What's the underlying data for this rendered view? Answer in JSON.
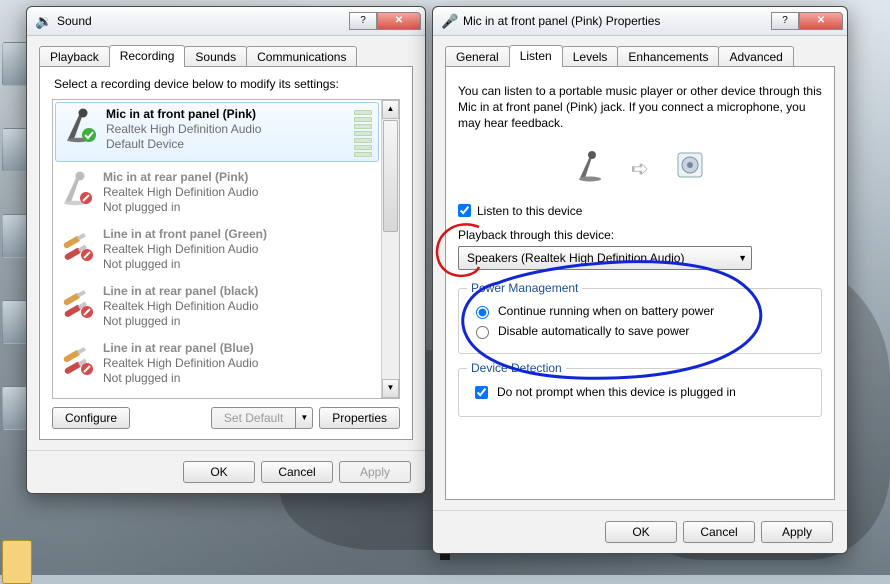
{
  "sound_window": {
    "title": "Sound",
    "tabs": [
      "Playback",
      "Recording",
      "Sounds",
      "Communications"
    ],
    "active_tab_index": 1,
    "instruction": "Select a recording device below to modify its settings:",
    "devices": [
      {
        "name": "Mic in at front panel (Pink)",
        "sub": "Realtek High Definition Audio",
        "status": "Default Device",
        "selected": true,
        "type": "mic",
        "enabled": true
      },
      {
        "name": "Mic in at rear panel (Pink)",
        "sub": "Realtek High Definition Audio",
        "status": "Not plugged in",
        "selected": false,
        "type": "mic",
        "enabled": false
      },
      {
        "name": "Line in at front panel (Green)",
        "sub": "Realtek High Definition Audio",
        "status": "Not plugged in",
        "selected": false,
        "type": "line",
        "enabled": false
      },
      {
        "name": "Line in at rear panel (black)",
        "sub": "Realtek High Definition Audio",
        "status": "Not plugged in",
        "selected": false,
        "type": "line",
        "enabled": false
      },
      {
        "name": "Line in at rear panel (Blue)",
        "sub": "Realtek High Definition Audio",
        "status": "Not plugged in",
        "selected": false,
        "type": "line",
        "enabled": false
      }
    ],
    "bottom_buttons": {
      "configure": "Configure",
      "set_default": "Set Default",
      "properties": "Properties"
    },
    "footer": {
      "ok": "OK",
      "cancel": "Cancel",
      "apply": "Apply"
    }
  },
  "props_window": {
    "title": "Mic in at front panel (Pink) Properties",
    "tabs": [
      "General",
      "Listen",
      "Levels",
      "Enhancements",
      "Advanced"
    ],
    "active_tab_index": 1,
    "description": "You can listen to a portable music player or other device through this Mic in at front panel (Pink) jack.  If you connect a microphone, you may hear feedback.",
    "listen_checkbox": {
      "label": "Listen to this device",
      "checked": true
    },
    "playback_label": "Playback through this device:",
    "playback_selected": "Speakers (Realtek High Definition Audio)",
    "power_group": {
      "legend": "Power Management",
      "opt_continue": "Continue running when on battery power",
      "opt_disable": "Disable automatically to save power",
      "selected": "continue"
    },
    "detect_group": {
      "legend": "Device Detection",
      "checkbox": {
        "label": "Do not prompt when this device is plugged in",
        "checked": true
      }
    },
    "footer": {
      "ok": "OK",
      "cancel": "Cancel",
      "apply": "Apply"
    }
  },
  "colors": {
    "annot_red": "#d81414",
    "annot_blue": "#1227d4"
  }
}
